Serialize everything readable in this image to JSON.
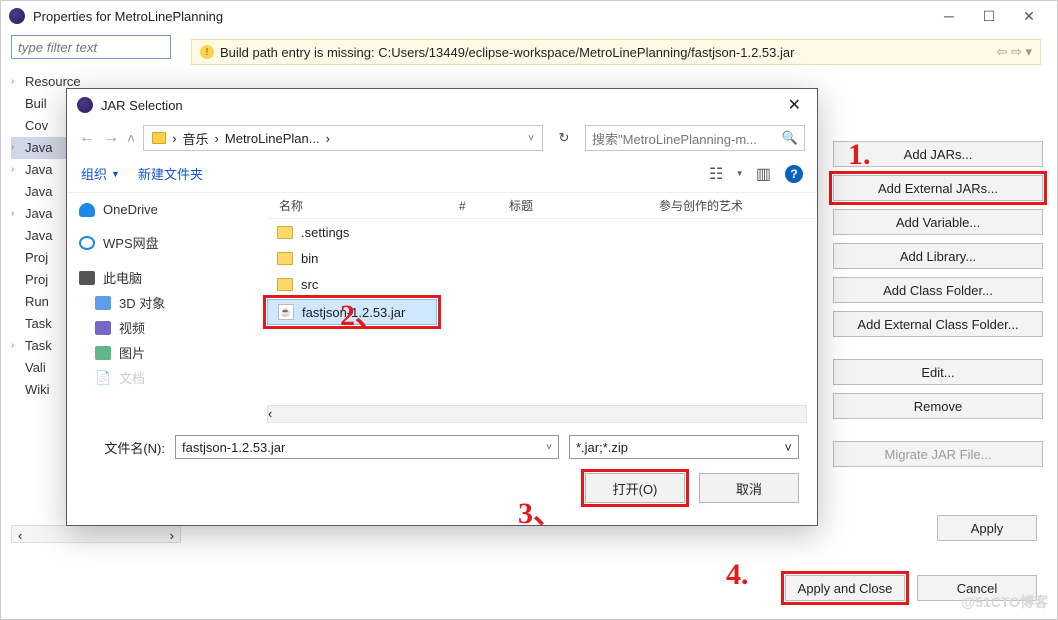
{
  "eclipse": {
    "title": "Properties for MetroLinePlanning",
    "filter_placeholder": "type filter text",
    "warning": "Build path entry is missing: C:Users/13449/eclipse-workspace/MetroLinePlanning/fastjson-1.2.53.jar",
    "tree": [
      "Resource",
      "Buil",
      "Cov",
      "Java",
      "Java",
      "Java",
      "Java",
      "Java",
      "Proj",
      "Proj",
      "Run",
      "Task",
      "Task",
      "Vali",
      "Wiki"
    ],
    "buttons": {
      "add_jars": "Add JARs...",
      "add_external_jars": "Add External JARs...",
      "add_variable": "Add Variable...",
      "add_library": "Add Library...",
      "add_class_folder": "Add Class Folder...",
      "add_ext_class_folder": "Add External Class Folder...",
      "edit": "Edit...",
      "remove": "Remove",
      "migrate": "Migrate JAR File...",
      "apply": "Apply",
      "apply_close": "Apply and Close",
      "cancel": "Cancel"
    }
  },
  "fd": {
    "title": "JAR Selection",
    "crumb1": "音乐",
    "crumb2": "MetroLinePlan...",
    "search_ph": "搜索\"MetroLinePlanning-m...",
    "organize": "组织",
    "new_folder": "新建文件夹",
    "col_name": "名称",
    "col_num": "#",
    "col_title": "标题",
    "col_artist": "参与创作的艺术",
    "nav": {
      "onedrive": "OneDrive",
      "wps": "WPS网盘",
      "pc": "此电脑",
      "obj": "3D 对象",
      "video": "视频",
      "img": "图片",
      "doc": "文档"
    },
    "items": [
      ".settings",
      "bin",
      "src",
      "fastjson-1.2.53.jar"
    ],
    "filename_label": "文件名(N):",
    "filename_value": "fastjson-1.2.53.jar",
    "filetype": "*.jar;*.zip",
    "open": "打开(O)",
    "cancel": "取消"
  },
  "watermark": "@51CTO博客"
}
